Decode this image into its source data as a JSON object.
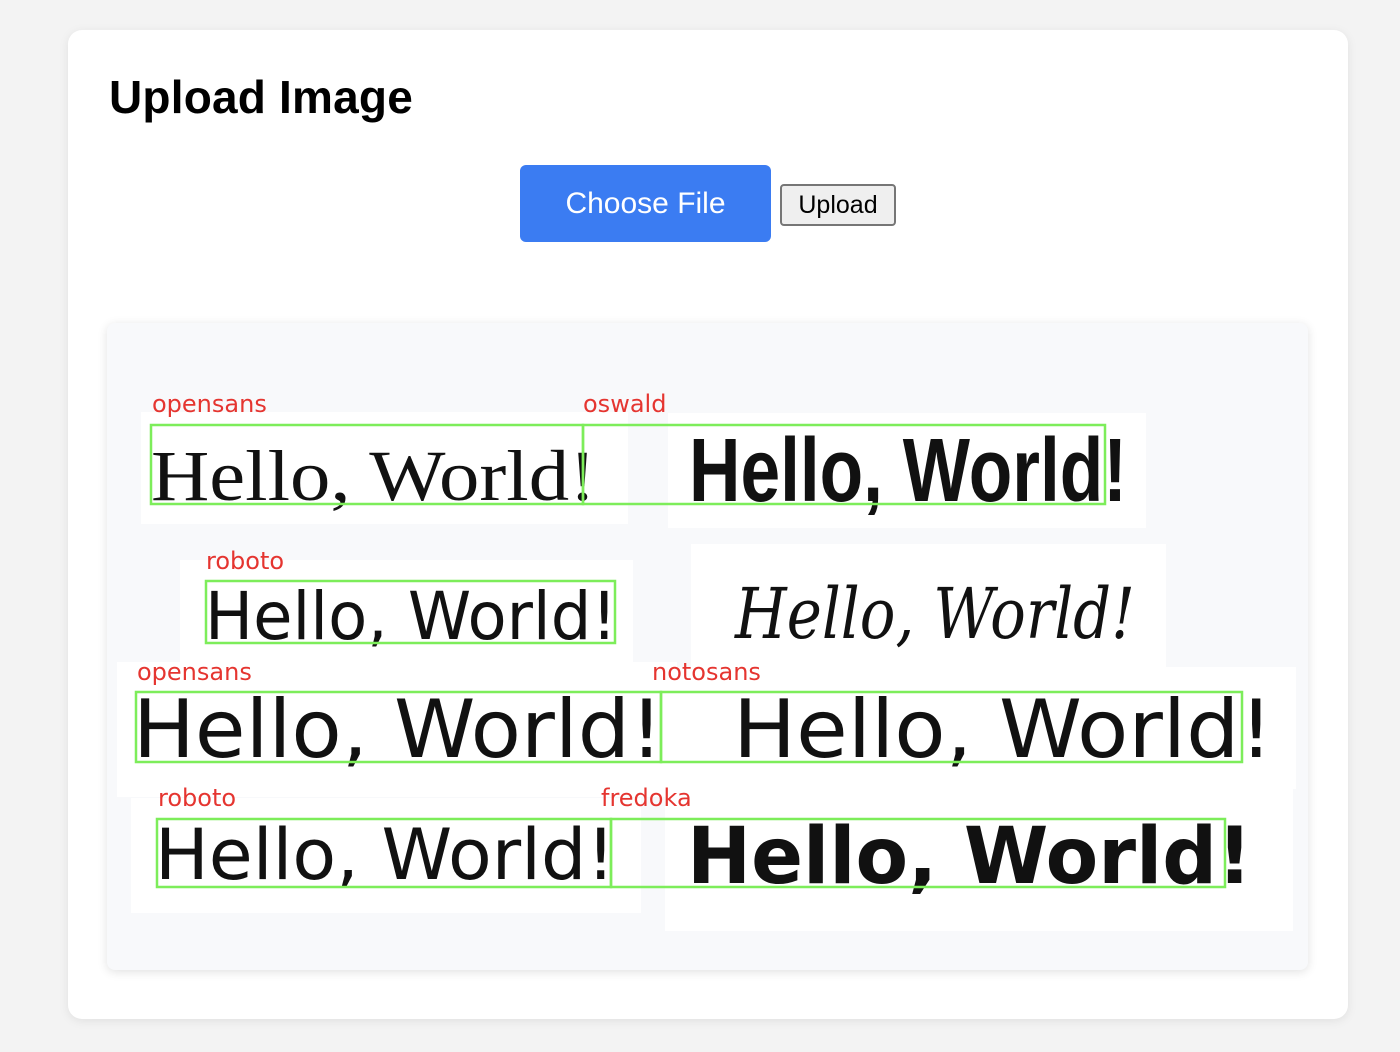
{
  "page": {
    "title": "Upload Image"
  },
  "controls": {
    "choose_file_label": "Choose File",
    "upload_label": "Upload"
  },
  "result": {
    "sample_text": "Hello, World!",
    "labels": {
      "l1": "opensans",
      "l2": "oswald",
      "l3": "roboto",
      "l4": "opensans",
      "l5": "notosans",
      "l6": "roboto",
      "l7": "fredoka"
    },
    "colors": {
      "label": "#e53530",
      "box": "#7ded5a"
    }
  }
}
